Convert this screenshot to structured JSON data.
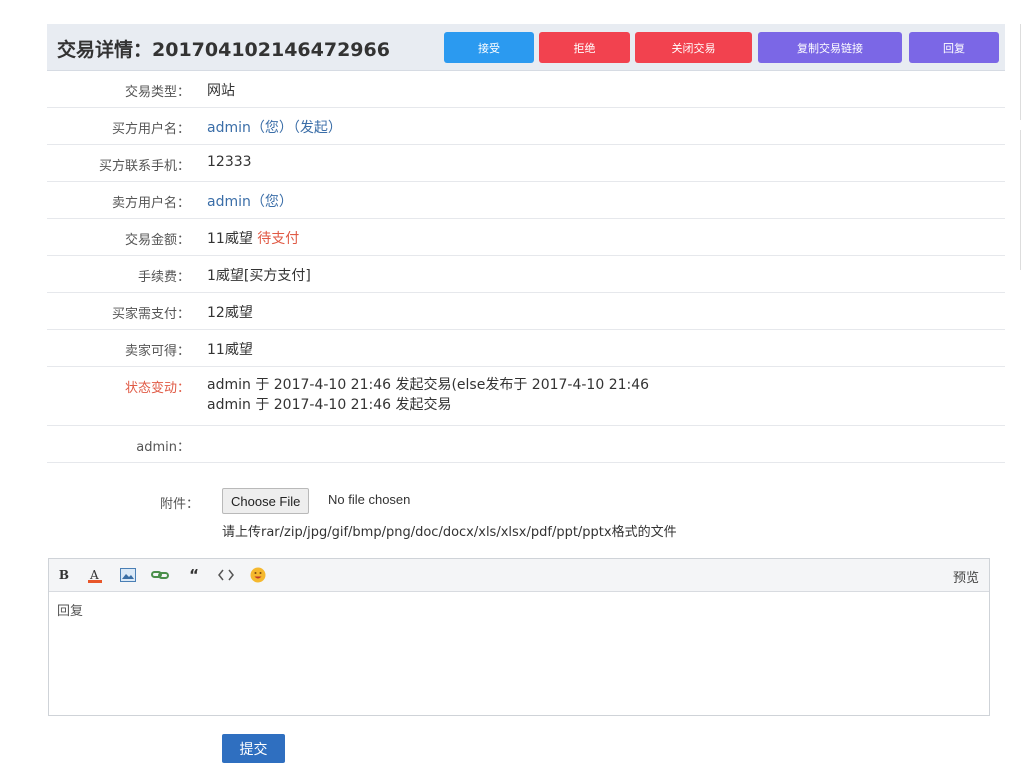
{
  "header": {
    "title": "交易详情：201704102146472966",
    "buttons": [
      "接受",
      "拒绝",
      "关闭交易",
      "复制交易链接",
      "回复"
    ]
  },
  "details": [
    {
      "label": "交易类型：",
      "value": "网站"
    },
    {
      "label": "买方用户名：",
      "value": "admin（您）（发起）"
    },
    {
      "label": "买方联系手机：",
      "value": "12333"
    },
    {
      "label": "卖方用户名：",
      "value": "admin（您）"
    },
    {
      "label": "交易金额：",
      "value": "11威望",
      "status": "待支付"
    },
    {
      "label": "手续费：",
      "value": "1威望[买方支付]"
    },
    {
      "label": "买家需支付：",
      "value": "12威望"
    },
    {
      "label": "卖家可得：",
      "value": "11威望"
    },
    {
      "label": "状态变动：",
      "line1": "admin 于 2017-4-10 21:46 发起交易(else发布于 2017-4-10 21:46",
      "line2": "admin 于 2017-4-10 21:46 发起交易"
    },
    {
      "label": "admin："
    }
  ],
  "attachment": {
    "label": "附件：",
    "choose_button": "Choose File",
    "no_file": "No file chosen",
    "hint": "请上传rar/zip/jpg/gif/bmp/png/doc/docx/xls/xlsx/pdf/ppt/pptx格式的文件"
  },
  "editor": {
    "preview": "预览",
    "content": "回复",
    "tools": [
      "bold-icon",
      "font-color-icon",
      "image-icon",
      "link-icon",
      "quote-icon",
      "code-icon",
      "emoji-icon"
    ]
  },
  "submit": "提交",
  "colors": {
    "blue": "#2b9af0",
    "red": "#f2424f",
    "purple": "#7b67e6",
    "submit": "#2f6fc0"
  }
}
